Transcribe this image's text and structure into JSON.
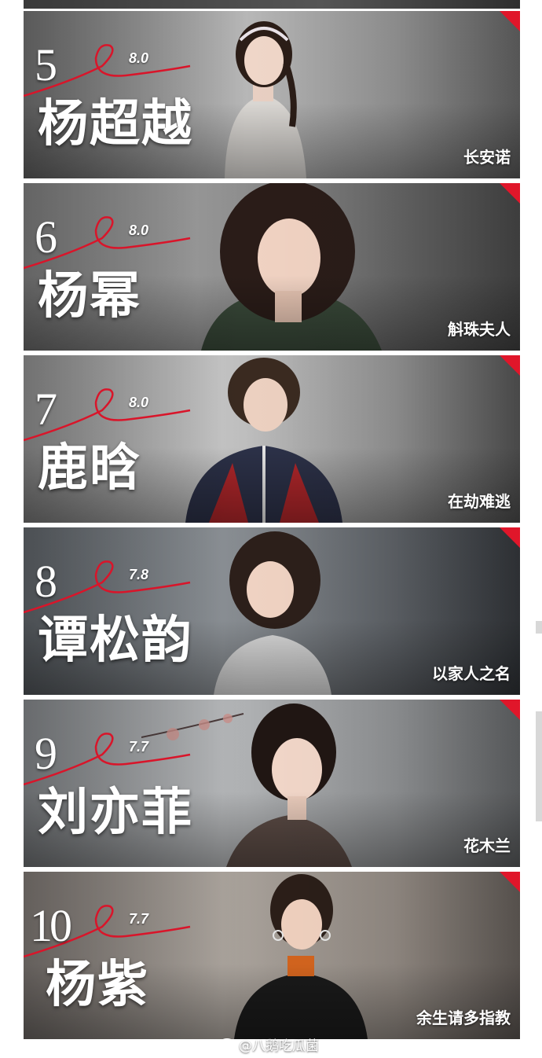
{
  "ranking": [
    {
      "rank": "5",
      "score": "8.0",
      "name": "杨超越",
      "drama": "长安诺"
    },
    {
      "rank": "6",
      "score": "8.0",
      "name": "杨幂",
      "drama": "斛珠夫人"
    },
    {
      "rank": "7",
      "score": "8.0",
      "name": "鹿晗",
      "drama": "在劫难逃"
    },
    {
      "rank": "8",
      "score": "7.8",
      "name": "谭松韵",
      "drama": "以家人之名"
    },
    {
      "rank": "9",
      "score": "7.7",
      "name": "刘亦菲",
      "drama": "花木兰"
    },
    {
      "rank": "10",
      "score": "7.7",
      "name": "杨紫",
      "drama": "余生请多指教"
    }
  ],
  "watermark": "@八鹅吃瓜菌",
  "colors": {
    "accent_red": "#e0162a",
    "text": "#ffffff"
  }
}
